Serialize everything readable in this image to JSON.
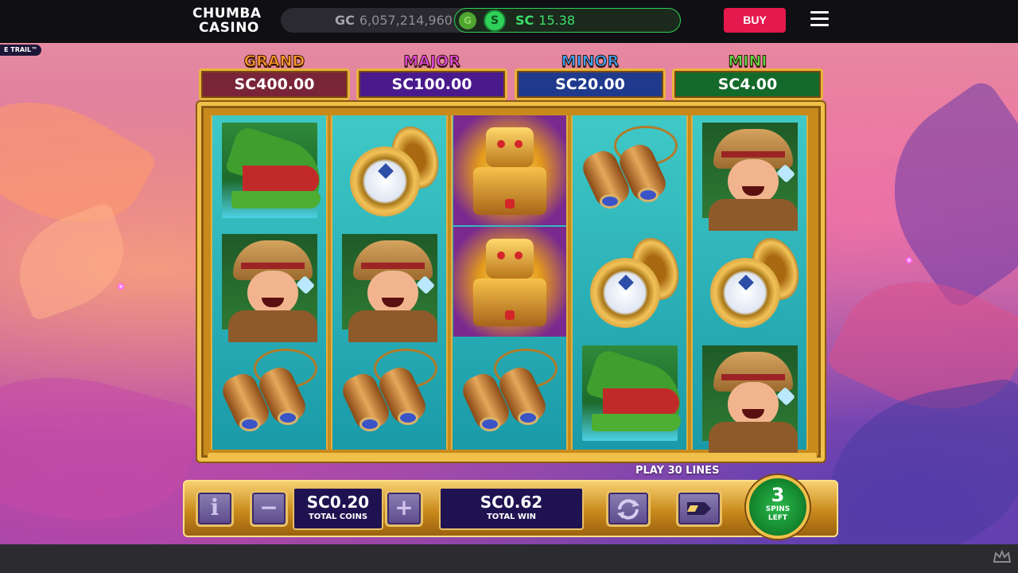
{
  "topbar": {
    "logo_line1": "CHUMBA",
    "logo_line2": "CASINO",
    "gc_label": "GC",
    "gc_value": "6,057,214,960",
    "gc_coin_glyph": "G",
    "sc_coin_glyph": "S",
    "sc_label": "SC",
    "sc_value": "15.38",
    "buy_label": "BUY"
  },
  "game": {
    "trail_tag": "E TRAIL™",
    "jackpots": [
      {
        "title": "GRAND",
        "value": "SC400.00",
        "title_color": "#ff9a2a",
        "box_color": "#7a2438"
      },
      {
        "title": "MAJOR",
        "value": "SC100.00",
        "title_color": "#e04ae0",
        "box_color": "#4a1a8c"
      },
      {
        "title": "MINOR",
        "value": "SC20.00",
        "title_color": "#3aa0ff",
        "box_color": "#1f3a8c"
      },
      {
        "title": "MINI",
        "value": "SC4.00",
        "title_color": "#5ad84a",
        "box_color": "#136a2a"
      }
    ],
    "reels": [
      [
        "crocodile",
        "explorer",
        "binoculars"
      ],
      [
        "compass",
        "explorer",
        "binoculars"
      ],
      [
        "golden-idol",
        "golden-idol",
        "binoculars"
      ],
      [
        "binoculars",
        "compass",
        "crocodile"
      ],
      [
        "explorer",
        "compass",
        "explorer"
      ]
    ],
    "play_lines": "PLAY 30 LINES",
    "controls": {
      "info_glyph": "i",
      "minus_glyph": "−",
      "plus_glyph": "+",
      "total_coins_value": "SC0.20",
      "total_coins_label": "TOTAL COINS",
      "total_win_value": "SC0.62",
      "total_win_label": "TOTAL WIN",
      "spins_count": "3",
      "spins_label_1": "SPINS",
      "spins_label_2": "LEFT"
    }
  },
  "colors": {
    "accent_green": "#2fd158",
    "buy_red": "#e5194d",
    "gold": "#f0c04a"
  },
  "icons": [
    "menu-icon",
    "autoplay-icon",
    "turbo-icon",
    "crown-icon",
    "info-icon",
    "minus-icon",
    "plus-icon"
  ]
}
